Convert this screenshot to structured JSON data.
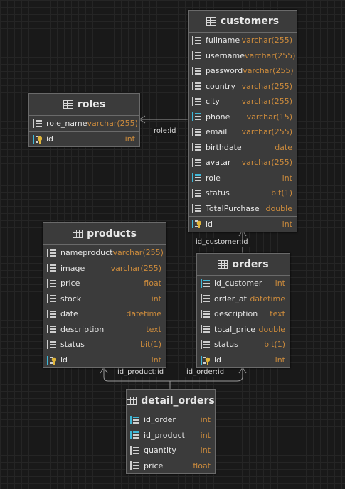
{
  "tables": {
    "customers": {
      "name": "customers",
      "columns": [
        {
          "name": "fullname",
          "type": "varchar(255)",
          "kind": "col"
        },
        {
          "name": "username",
          "type": "varchar(255)",
          "kind": "col"
        },
        {
          "name": "password",
          "type": "varchar(255)",
          "kind": "col"
        },
        {
          "name": "country",
          "type": "varchar(255)",
          "kind": "col"
        },
        {
          "name": "city",
          "type": "varchar(255)",
          "kind": "col"
        },
        {
          "name": "phone",
          "type": "varchar(15)",
          "kind": "fk"
        },
        {
          "name": "email",
          "type": "varchar(255)",
          "kind": "col"
        },
        {
          "name": "birthdate",
          "type": "date",
          "kind": "col"
        },
        {
          "name": "avatar",
          "type": "varchar(255)",
          "kind": "col"
        },
        {
          "name": "role",
          "type": "int",
          "kind": "fk"
        },
        {
          "name": "status",
          "type": "bit(1)",
          "kind": "col"
        },
        {
          "name": "TotalPurchase",
          "type": "double",
          "kind": "col"
        },
        {
          "name": "id",
          "type": "int",
          "kind": "pk"
        }
      ]
    },
    "roles": {
      "name": "roles",
      "columns": [
        {
          "name": "role_name",
          "type": "varchar(255)",
          "kind": "col"
        },
        {
          "name": "id",
          "type": "int",
          "kind": "pk"
        }
      ]
    },
    "products": {
      "name": "products",
      "columns": [
        {
          "name": "nameproduct",
          "type": "varchar(255)",
          "kind": "col"
        },
        {
          "name": "image",
          "type": "varchar(255)",
          "kind": "col"
        },
        {
          "name": "price",
          "type": "float",
          "kind": "col"
        },
        {
          "name": "stock",
          "type": "int",
          "kind": "col"
        },
        {
          "name": "date",
          "type": "datetime",
          "kind": "col"
        },
        {
          "name": "description",
          "type": "text",
          "kind": "col"
        },
        {
          "name": "status",
          "type": "bit(1)",
          "kind": "col"
        },
        {
          "name": "id",
          "type": "int",
          "kind": "pk"
        }
      ]
    },
    "orders": {
      "name": "orders",
      "columns": [
        {
          "name": "id_customer",
          "type": "int",
          "kind": "fk"
        },
        {
          "name": "order_at",
          "type": "datetime",
          "kind": "col"
        },
        {
          "name": "description",
          "type": "text",
          "kind": "col"
        },
        {
          "name": "total_price",
          "type": "double",
          "kind": "col"
        },
        {
          "name": "status",
          "type": "bit(1)",
          "kind": "col"
        },
        {
          "name": "id",
          "type": "int",
          "kind": "pk"
        }
      ]
    },
    "detail_orders": {
      "name": "detail_orders",
      "columns": [
        {
          "name": "id_order",
          "type": "int",
          "kind": "fk"
        },
        {
          "name": "id_product",
          "type": "int",
          "kind": "fk"
        },
        {
          "name": "quantity",
          "type": "int",
          "kind": "col"
        },
        {
          "name": "price",
          "type": "float",
          "kind": "col"
        }
      ]
    }
  },
  "relations": {
    "customers_roles": "role:id",
    "orders_customers": "id_customer:id",
    "detail_products": "id_product:id",
    "detail_orders": "id_order:id"
  },
  "colors": {
    "canvas": "#191919",
    "table_bg": "#3b3b3b",
    "column_name": "#e6e6e6",
    "column_type": "#cc8b3c",
    "link": "#9a9a9a"
  }
}
